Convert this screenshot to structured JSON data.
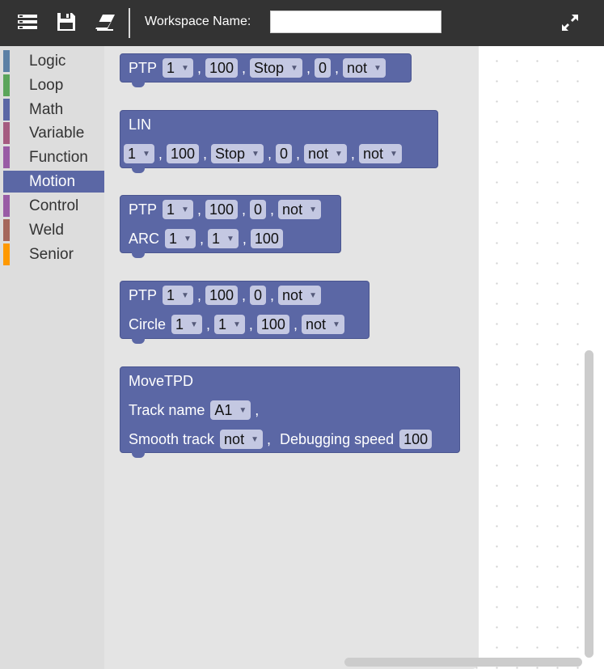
{
  "toolbar": {
    "menu_icon": "menu-lines-icon",
    "save_icon": "floppy-disk-icon",
    "clear_icon": "eraser-icon",
    "workspace_label": "Workspace Name:",
    "workspace_value": "",
    "fullscreen_icon": "expand-icon"
  },
  "categories": [
    {
      "label": "Logic",
      "color": "#5b80a5"
    },
    {
      "label": "Loop",
      "color": "#5ba55b"
    },
    {
      "label": "Math",
      "color": "#5b67a5"
    },
    {
      "label": "Variable",
      "color": "#a55b80"
    },
    {
      "label": "Function",
      "color": "#995ba5"
    },
    {
      "label": "Motion",
      "color": "#5b67a5",
      "selected": true
    },
    {
      "label": "Control",
      "color": "#995ba5"
    },
    {
      "label": "Weld",
      "color": "#a5675b"
    },
    {
      "label": "Senior",
      "color": "#ff9900"
    }
  ],
  "blocks": {
    "ptp": {
      "label": "PTP",
      "f1": "1",
      "f2": "100",
      "f3": "Stop",
      "f4": "0",
      "f5": "not"
    },
    "lin": {
      "label": "LIN",
      "f1": "1",
      "f2": "100",
      "f3": "Stop",
      "f4": "0",
      "f5": "not",
      "f6": "not"
    },
    "ptp_arc": {
      "label": "PTP",
      "f1": "1",
      "f2": "100",
      "f3": "0",
      "f4": "not",
      "arc_label": "ARC",
      "a1": "1",
      "a2": "1",
      "a3": "100"
    },
    "ptp_circle": {
      "label": "PTP",
      "f1": "1",
      "f2": "100",
      "f3": "0",
      "f4": "not",
      "circle_label": "Circle",
      "c1": "1",
      "c2": "1",
      "c3": "100",
      "c4": "not"
    },
    "movetpd": {
      "label": "MoveTPD",
      "track_label": "Track name",
      "track_value": "A1",
      "smooth_label": "Smooth track",
      "smooth_value": "not",
      "speed_label": "Debugging speed",
      "speed_value": "100"
    }
  },
  "separator": ","
}
